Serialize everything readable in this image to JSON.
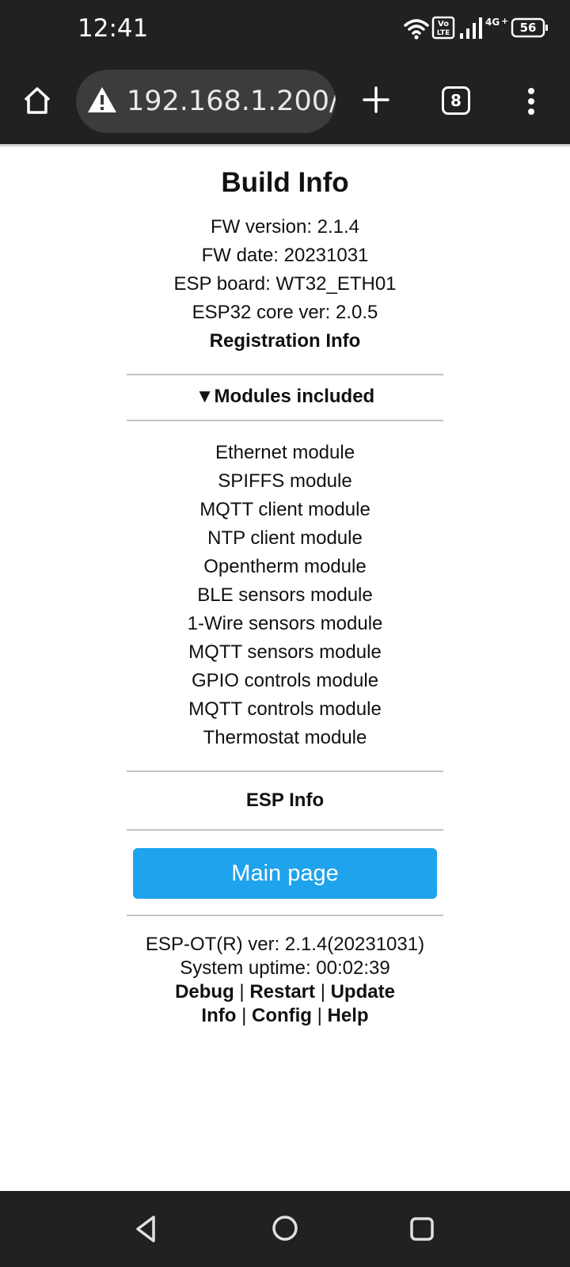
{
  "status_bar": {
    "time": "12:41",
    "network": "4G+",
    "volte": "Vo LTE",
    "battery": "56"
  },
  "browser": {
    "url": "192.168.1.200/",
    "tab_count": "8"
  },
  "page": {
    "title": "Build Info",
    "info_lines": [
      "FW version: 2.1.4",
      "FW date: 20231031",
      "ESP board: WT32_ETH01",
      "ESP32 core ver: 2.0.5"
    ],
    "registration_link": "Registration Info",
    "modules_summary": "▼Modules included",
    "modules": [
      "Ethernet module",
      "SPIFFS module",
      "MQTT client module",
      "NTP client module",
      "Opentherm module",
      "BLE sensors module",
      "1-Wire sensors module",
      "MQTT sensors module",
      "GPIO controls module",
      "MQTT controls module",
      "Thermostat module"
    ],
    "esp_info_link": "ESP Info",
    "main_button": "Main page"
  },
  "footer": {
    "version_line": "ESP-OT(R) ver: 2.1.4(20231031)",
    "uptime_line": "System uptime: 00:02:39",
    "links_row1": [
      "Debug",
      "Restart",
      "Update"
    ],
    "links_row2": [
      "Info",
      "Config",
      "Help"
    ],
    "separator": "|"
  },
  "colors": {
    "system_bar": "#212121",
    "url_box": "#3c3c3c",
    "main_button": "#1fa3ec",
    "divider": "#c4c4c4"
  }
}
